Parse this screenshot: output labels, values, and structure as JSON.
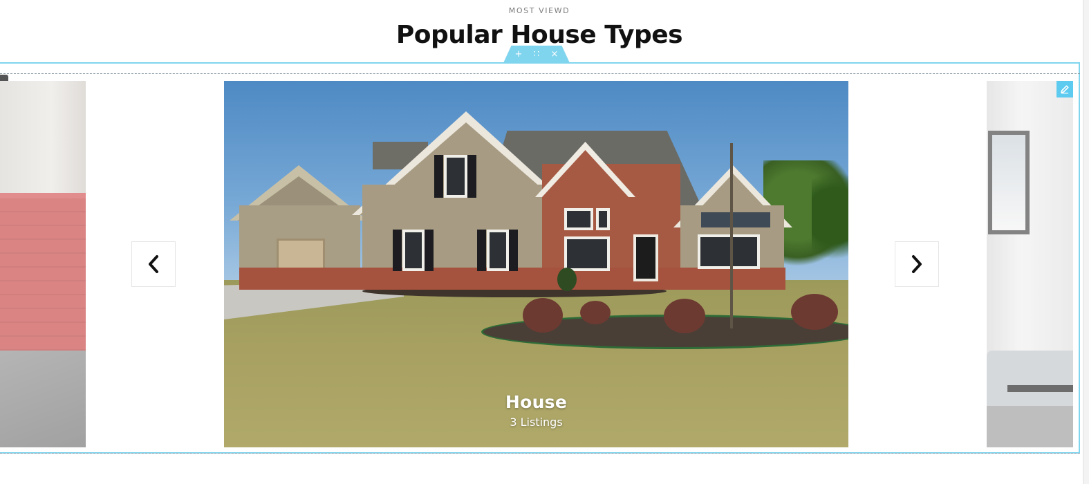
{
  "header": {
    "eyebrow": "MOST VIEWD",
    "title": "Popular House Types"
  },
  "editor_toolbar": {
    "add": "+",
    "move": "∷",
    "remove": "×"
  },
  "slider": {
    "active_slide": {
      "title": "House",
      "subtitle": "3 Listings"
    }
  },
  "colors": {
    "accent": "#7fd4ee",
    "edit_button": "#5ccbef",
    "title": "#111111"
  },
  "icons": {
    "prev": "chevron-left-icon",
    "next": "chevron-right-icon",
    "edit": "pencil-icon"
  }
}
